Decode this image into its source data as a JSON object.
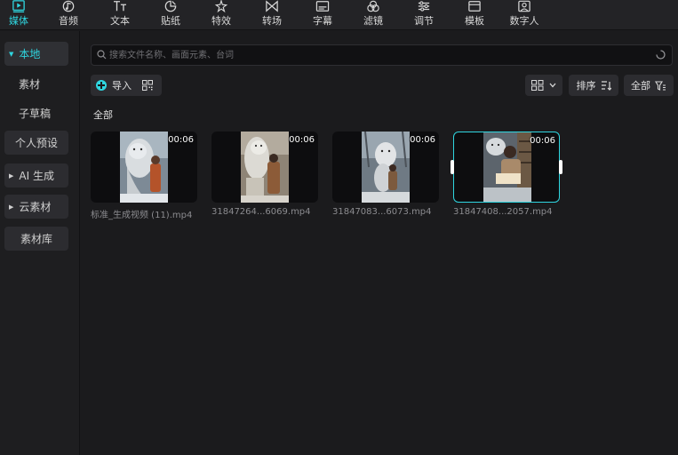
{
  "toolbar": {
    "tabs": [
      {
        "label": "媒体",
        "icon": "media-icon",
        "active": true
      },
      {
        "label": "音频",
        "icon": "audio-icon"
      },
      {
        "label": "文本",
        "icon": "text-icon"
      },
      {
        "label": "贴纸",
        "icon": "sticker-icon"
      },
      {
        "label": "特效",
        "icon": "effects-icon"
      },
      {
        "label": "转场",
        "icon": "transition-icon"
      },
      {
        "label": "字幕",
        "icon": "subtitle-icon"
      },
      {
        "label": "滤镜",
        "icon": "filter-icon"
      },
      {
        "label": "调节",
        "icon": "adjust-icon"
      },
      {
        "label": "模板",
        "icon": "template-icon"
      },
      {
        "label": "数字人",
        "icon": "digital-human-icon"
      }
    ],
    "accent_color": "#2fd6e0"
  },
  "sidebar": {
    "items": [
      {
        "label": "本地",
        "expandable": true,
        "active": true
      },
      {
        "label": "素材"
      },
      {
        "label": "子草稿"
      },
      {
        "label": "个人预设"
      },
      {
        "label": "AI 生成",
        "expandable": true
      },
      {
        "label": "云素材",
        "expandable": true
      },
      {
        "label": "素材库"
      }
    ]
  },
  "search": {
    "placeholder": "搜索文件名称、画面元素、台词",
    "value": ""
  },
  "actions": {
    "import_label": "导入",
    "sort_label": "排序",
    "filter_label": "全部"
  },
  "section": {
    "label": "全部"
  },
  "media": [
    {
      "duration": "00:06",
      "filename": "标准_生成视频 (11).mp4",
      "selected": false
    },
    {
      "duration": "00:06",
      "filename": "31847264...6069.mp4",
      "selected": false
    },
    {
      "duration": "00:06",
      "filename": "31847083...6073.mp4",
      "selected": false
    },
    {
      "duration": "00:06",
      "filename": "31847408...2057.mp4",
      "selected": true
    }
  ]
}
